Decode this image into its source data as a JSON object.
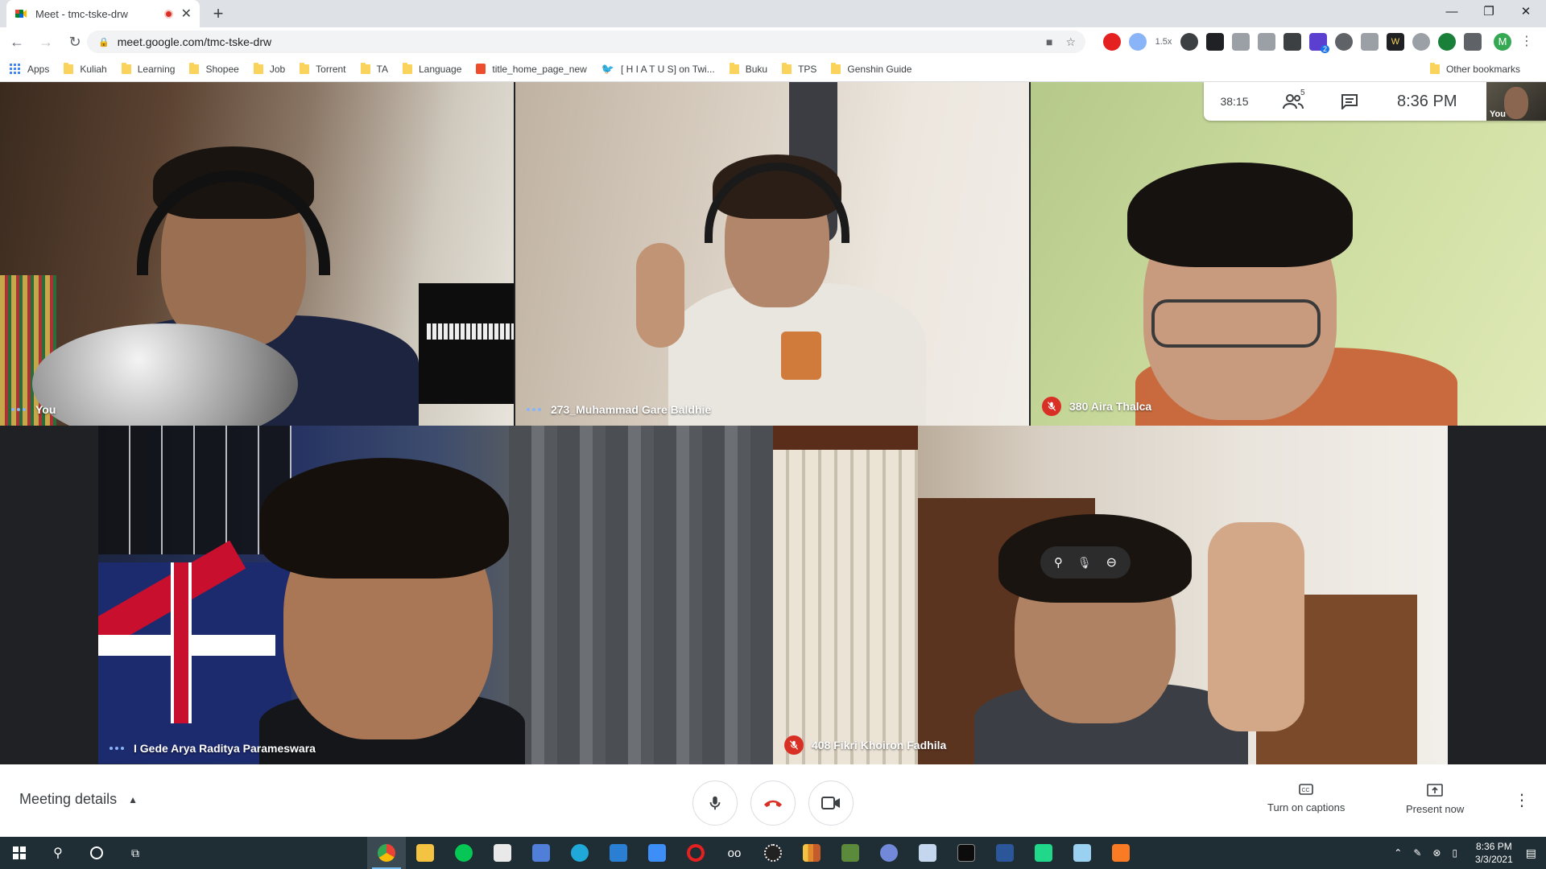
{
  "browser": {
    "tab_title": "Meet - tmc-tske-drw",
    "url": "meet.google.com/tmc-tske-drw",
    "zoom_badge": "1.5x",
    "profile_initial": "M",
    "ext_badge": "2"
  },
  "bookmarks": [
    {
      "label": "Apps",
      "kind": "apps"
    },
    {
      "label": "Kuliah",
      "kind": "folder"
    },
    {
      "label": "Learning",
      "kind": "folder"
    },
    {
      "label": "Shopee",
      "kind": "folder"
    },
    {
      "label": "Job",
      "kind": "folder"
    },
    {
      "label": "Torrent",
      "kind": "folder"
    },
    {
      "label": "TA",
      "kind": "folder"
    },
    {
      "label": "Language",
      "kind": "folder"
    },
    {
      "label": "title_home_page_new",
      "kind": "shopee"
    },
    {
      "label": "[ H I A T U S] on Twi...",
      "kind": "twitter"
    },
    {
      "label": "Buku",
      "kind": "folder"
    },
    {
      "label": "TPS",
      "kind": "folder"
    },
    {
      "label": "Genshin Guide",
      "kind": "folder"
    }
  ],
  "other_bookmarks": "Other bookmarks",
  "meeting": {
    "elapsed": "38:15",
    "participant_count": "5",
    "clock": "8:36 PM",
    "self_label": "You"
  },
  "participants": [
    {
      "name": "You",
      "muted": false
    },
    {
      "name": "273_Muhammad Gare Baldhie",
      "muted": false
    },
    {
      "name": "380 Aira Thalca",
      "muted": true
    },
    {
      "name": "I Gede Arya Raditya Parameswara",
      "muted": false
    },
    {
      "name": "408 Fikri Khoiron Fadhila",
      "muted": true
    }
  ],
  "bottom": {
    "meeting_details": "Meeting details",
    "captions": "Turn on captions",
    "present": "Present now"
  },
  "taskbar": {
    "time": "8:36 PM",
    "date": "3/3/2021"
  },
  "colors": {
    "meet_red": "#d93025",
    "meet_blue_dots": "#8ab4f8",
    "taskbar": "#1f2d34"
  }
}
